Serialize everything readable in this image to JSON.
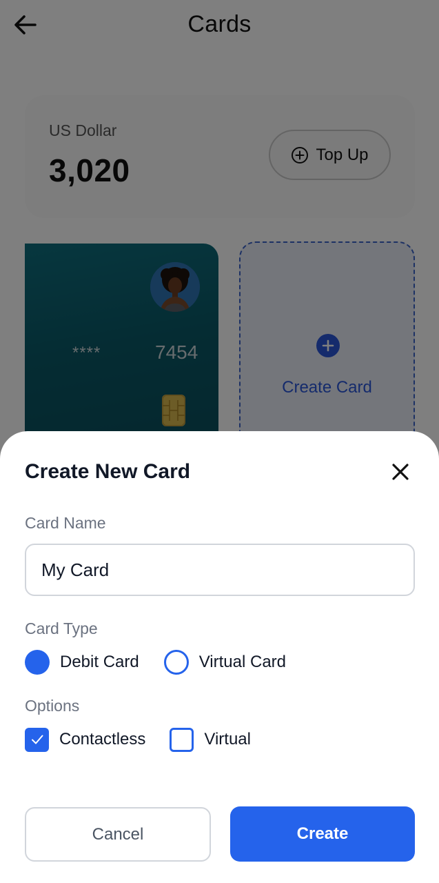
{
  "header": {
    "title": "Cards",
    "back_icon": "arrow-left-icon"
  },
  "balance": {
    "currency": "US Dollar",
    "amount": "3,020",
    "topup_label": "Top Up",
    "topup_icon": "plus-circle-icon"
  },
  "card": {
    "masked": "****",
    "last4": "7454",
    "color": "#0a5866",
    "chip_icon": "chip-icon",
    "avatar_icon": "avatar"
  },
  "create_card_tile": {
    "label": "Create Card",
    "icon": "plus-circle-icon"
  },
  "modal": {
    "title": "Create New Card",
    "close_icon": "close-icon",
    "name_label": "Card Name",
    "name_value": "My Card",
    "type_label": "Card Type",
    "type_options": [
      {
        "label": "Debit Card",
        "selected": true
      },
      {
        "label": "Virtual Card",
        "selected": false
      }
    ],
    "options_label": "Options",
    "checkbox_options": [
      {
        "label": "Contactless",
        "checked": true
      },
      {
        "label": "Virtual",
        "checked": false
      }
    ],
    "cancel_label": "Cancel",
    "create_label": "Create"
  },
  "colors": {
    "accent": "#2563eb",
    "overlay": "rgba(0,0,0,0.5)"
  }
}
